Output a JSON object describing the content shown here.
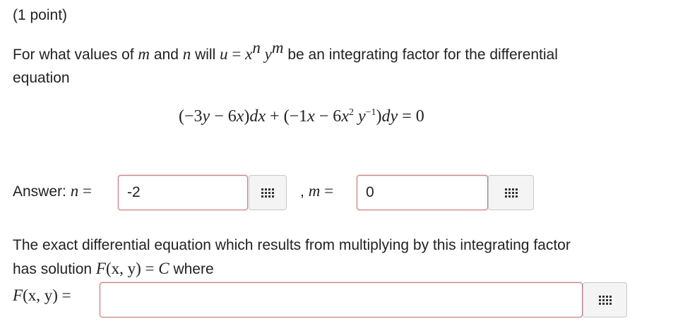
{
  "header": {
    "points": "(1 point)"
  },
  "question": {
    "text_before_m": "For what values of ",
    "m_var": "m",
    "and_word": " and ",
    "n_var": "n",
    "will_word": " will ",
    "u_var": "u",
    "equals": " = ",
    "x_var": "x",
    "x_exp": "n",
    "y_var": "y",
    "y_exp": "m",
    "text_after": " be an integrating factor for the differential",
    "line2": "equation"
  },
  "equation": {
    "left": "(−3",
    "y1": "y",
    "minus6x": " − 6",
    "x1": "x",
    "paren_dx": ")",
    "dx": "dx",
    "plus": " + (−1",
    "x2": "x",
    "minus6": " − 6",
    "x3": "x",
    "x3_exp": "2",
    "y2": "y",
    "y2_exp": "−1",
    "paren_dy": ")",
    "dy": "dy",
    "rhs": " = 0"
  },
  "answer": {
    "label": "Answer: ",
    "n_var": "n",
    "eq": " =",
    "n_value": "-2",
    "comma": ",",
    "m_var": "m",
    "m_eq": " =",
    "m_value": "0"
  },
  "second_part": {
    "line1": "The exact differential equation which results from multiplying by this integrating factor",
    "line2_a": "has solution ",
    "F_expr": "F",
    "F_args": "(x, y) = ",
    "C_var": "C",
    "line2_b": " where",
    "F_label": "F",
    "F_label_args": "(x, y) =",
    "F_value": ""
  }
}
